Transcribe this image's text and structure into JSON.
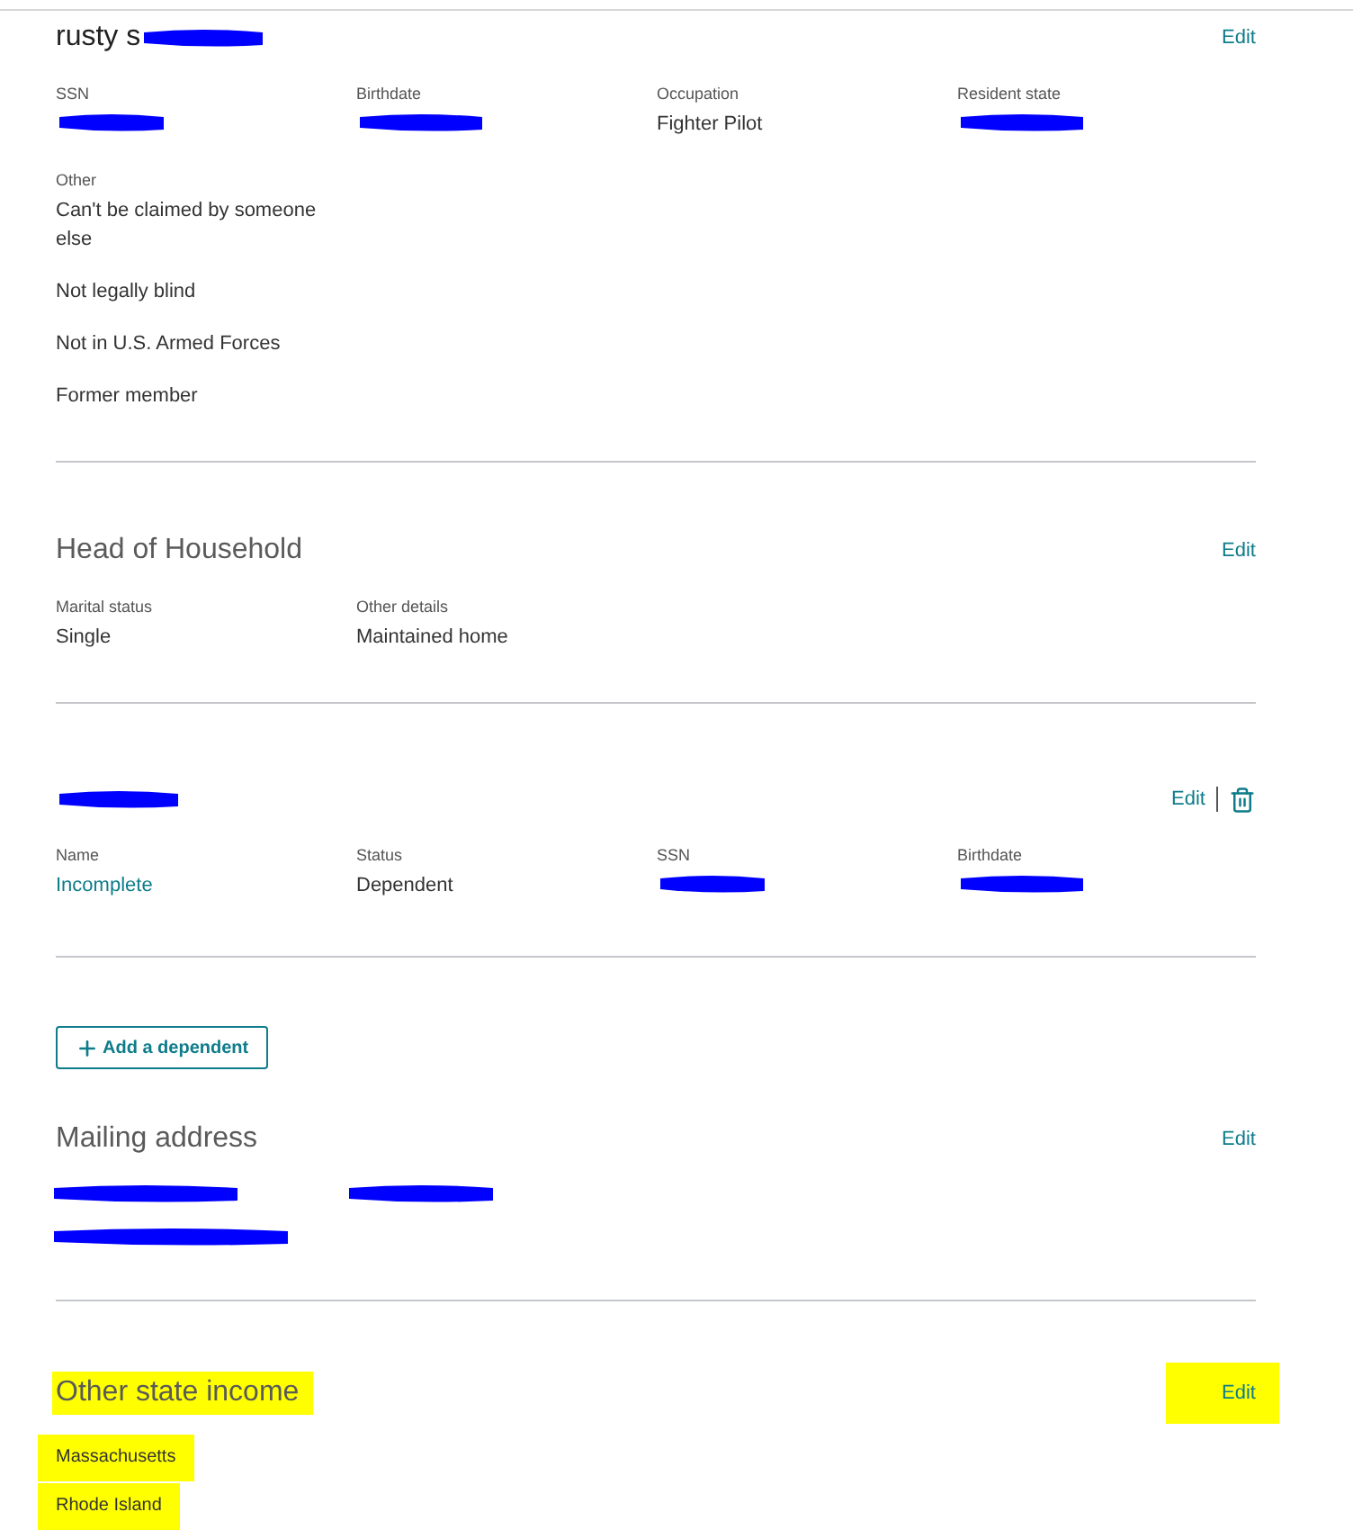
{
  "sections": [
    {
      "kind": "person",
      "title": "rusty s",
      "title_redacted": true,
      "action": "Edit",
      "fields": [
        {
          "label": "SSN",
          "redacted": true
        },
        {
          "label": "Birthdate",
          "redacted": true
        },
        {
          "label": "Occupation",
          "value": "Fighter Pilot"
        },
        {
          "label": "Resident state",
          "redacted": true
        }
      ],
      "other": {
        "label": "Other",
        "items": [
          "Can't be claimed by someone else",
          "Not legally blind",
          "Not in U.S. Armed Forces",
          "Former member"
        ]
      }
    },
    {
      "kind": "filing",
      "title": "Head of Household",
      "action": "Edit",
      "fields": [
        {
          "label": "Marital status",
          "value": "Single"
        },
        {
          "label": "Other details",
          "value": "Maintained home"
        }
      ]
    },
    {
      "kind": "dependent",
      "title_redacted": true,
      "action": "Edit",
      "deletable": true,
      "fields": [
        {
          "label": "Name",
          "value": "Incomplete",
          "emphasis": true
        },
        {
          "label": "Status",
          "value": "Dependent"
        },
        {
          "label": "SSN",
          "redacted": true
        },
        {
          "label": "Birthdate",
          "redacted": true
        }
      ]
    },
    {
      "kind": "add",
      "button": "Add a dependent"
    },
    {
      "kind": "address",
      "title": "Mailing address",
      "action": "Edit",
      "lines": [
        {
          "parts": [
            {
              "redacted": true
            },
            {
              "redacted": true
            }
          ]
        },
        {
          "parts": [
            {
              "redacted": true
            }
          ]
        }
      ]
    },
    {
      "kind": "states",
      "title": "Other state income",
      "highlighted": true,
      "action": "Edit",
      "action_highlighted": true,
      "items": [
        {
          "text": "Massachusetts",
          "highlighted": true
        },
        {
          "text": "Rhode Island",
          "highlighted": true
        }
      ]
    }
  ]
}
